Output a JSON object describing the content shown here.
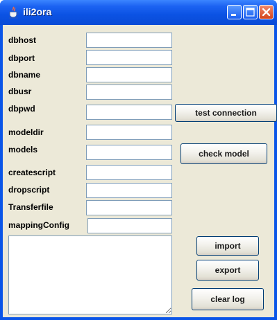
{
  "window": {
    "title": "ili2ora"
  },
  "form": {
    "fields": [
      {
        "label": "dbhost",
        "value": ""
      },
      {
        "label": "dbport",
        "value": ""
      },
      {
        "label": "dbname",
        "value": ""
      },
      {
        "label": "dbusr",
        "value": ""
      },
      {
        "label": "dbpwd",
        "value": ""
      },
      {
        "label": "modeldir",
        "value": ""
      },
      {
        "label": "models",
        "value": ""
      },
      {
        "label": "createscript",
        "value": ""
      },
      {
        "label": "dropscript",
        "value": ""
      },
      {
        "label": "Transferfile",
        "value": ""
      },
      {
        "label": "mappingConfig",
        "value": ""
      }
    ]
  },
  "buttons": {
    "test_connection": "test connection",
    "check_model": "check model",
    "import": "import",
    "export": "export",
    "clear_log": "clear log"
  },
  "log": {
    "text": ""
  },
  "colors": {
    "title_bar": "#0a55e8",
    "client_bg": "#ece9d8",
    "close_button": "#d4441c"
  },
  "icons": {
    "app": "java-cup-icon",
    "minimize": "minimize-icon",
    "maximize": "maximize-icon",
    "close": "close-icon"
  }
}
